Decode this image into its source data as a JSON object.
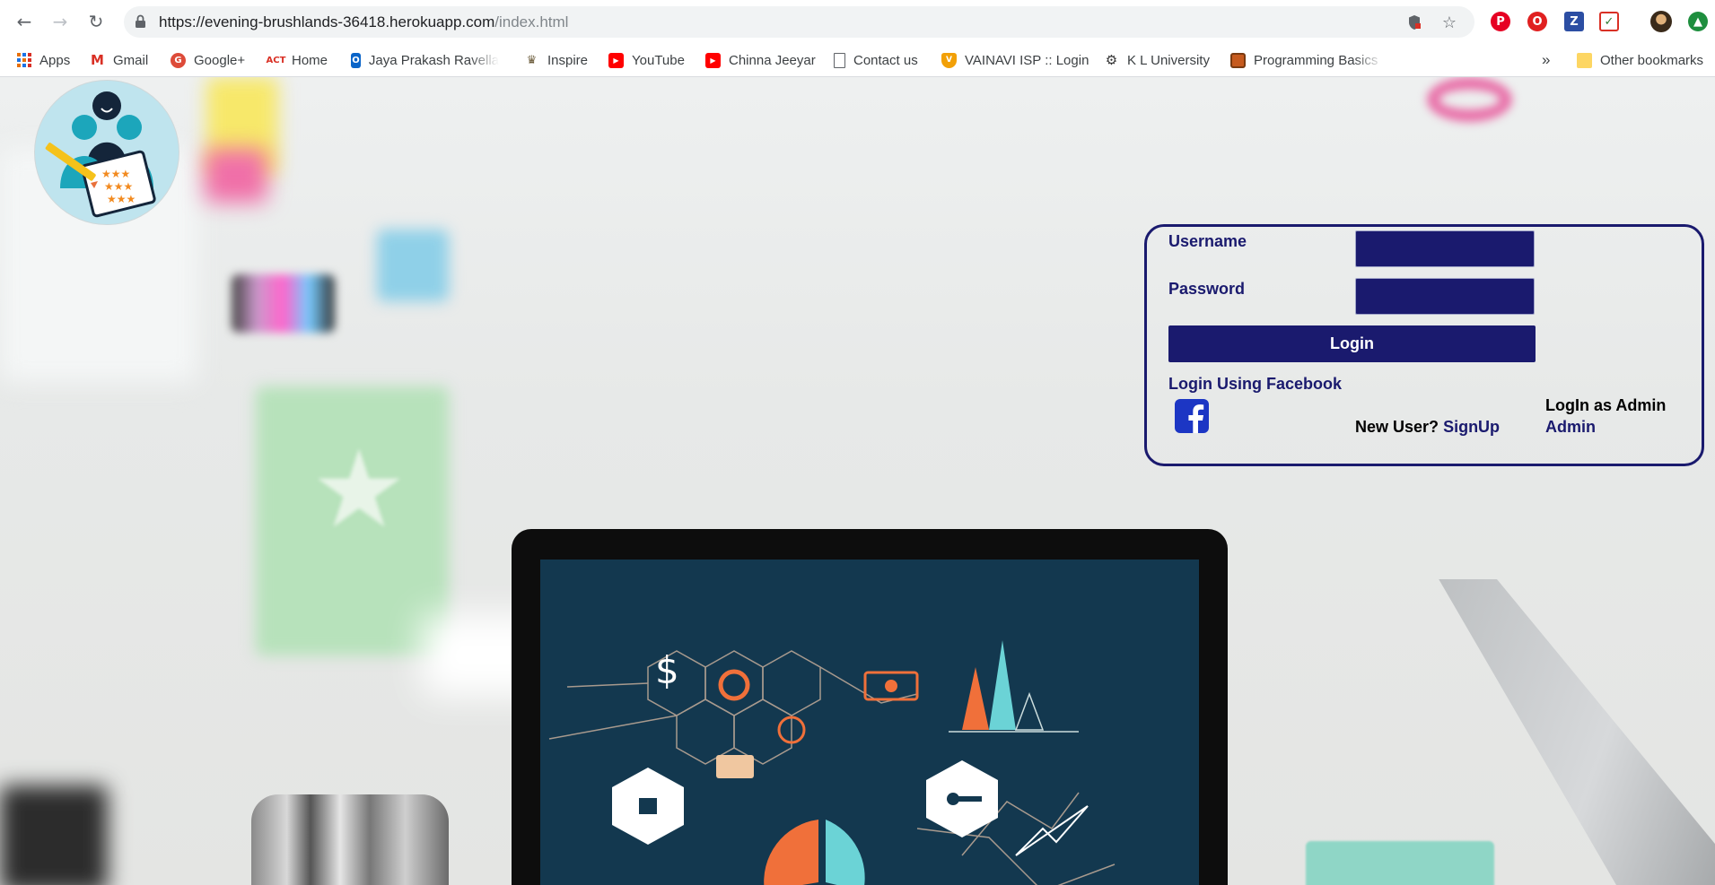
{
  "browser": {
    "url_host": "https://evening-brushlands-36418.herokuapp.com",
    "url_path": "/index.html",
    "bookmarks": [
      {
        "label": "Apps",
        "icon": "apps-grid-icon"
      },
      {
        "label": "Gmail",
        "icon": "gmail-icon"
      },
      {
        "label": "Google+",
        "icon": "google-plus-icon"
      },
      {
        "label": "Home",
        "icon": "act-icon"
      },
      {
        "label": "Jaya Prakash Ravella",
        "icon": "outlook-icon"
      },
      {
        "label": "Inspire",
        "icon": "emblem-icon"
      },
      {
        "label": "YouTube",
        "icon": "youtube-icon"
      },
      {
        "label": "Chinna Jeeyar",
        "icon": "youtube-icon"
      },
      {
        "label": "Contact us",
        "icon": "page-icon"
      },
      {
        "label": "VAINAVI ISP :: Login",
        "icon": "shield-icon"
      },
      {
        "label": "K L University",
        "icon": "gear-icon"
      },
      {
        "label": "Programming Basics",
        "icon": "book-icon"
      }
    ],
    "overflow_label": "»",
    "other_bookmarks": "Other bookmarks"
  },
  "login": {
    "username_label": "Username",
    "password_label": "Password",
    "login_button": "Login",
    "facebook_label": "Login Using Facebook",
    "new_user_text": "New User?",
    "signup_link": "SignUp",
    "admin_heading": "LogIn as Admin",
    "admin_link": "Admin"
  },
  "colors": {
    "accent": "#1a1a6e",
    "facebook": "#1c36c4"
  }
}
